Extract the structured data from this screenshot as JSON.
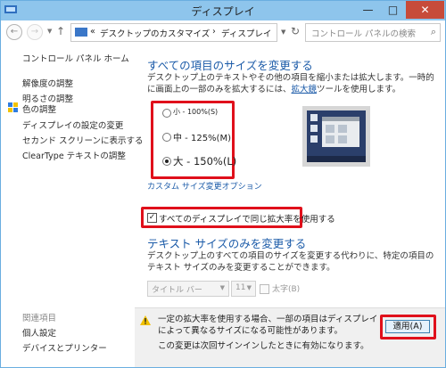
{
  "window": {
    "title": "ディスプレイ",
    "min_label": "—",
    "max_label": "□",
    "close_label": "✕"
  },
  "nav": {
    "back_icon": "back-arrow-icon",
    "forward_icon": "forward-arrow-icon",
    "breadcrumb": [
      "«",
      "デスクトップのカスタマイズ",
      "›",
      "ディスプレイ"
    ],
    "search_placeholder": "コントロール パネルの検索"
  },
  "sidebar": {
    "home": "コントロール パネル ホーム",
    "items": [
      {
        "label": "解像度の調整"
      },
      {
        "label": "明るさの調整"
      },
      {
        "label": "色の調整"
      },
      {
        "label": "ディスプレイの設定の変更"
      },
      {
        "label": "セカンド スクリーンに表示する"
      },
      {
        "label": "ClearType テキストの調整"
      }
    ],
    "related_heading": "関連項目",
    "related": [
      {
        "label": "個人設定"
      },
      {
        "label": "デバイスとプリンター"
      }
    ]
  },
  "main": {
    "heading1": "すべての項目のサイズを変更する",
    "para1_a": "デスクトップ上のテキストやその他の項目を縮小または拡大します。一時的に画面上の一部のみを拡大するには、",
    "para1_link": "拡大鏡",
    "para1_b": "ツールを使用します。",
    "size_options": [
      {
        "label": "小 - 100%(S)",
        "selected": false
      },
      {
        "label": "中 - 125%(M)",
        "selected": false
      },
      {
        "label": "大 - 150%(L)",
        "selected": true
      }
    ],
    "custom_link": "カスタム サイズ変更オプション",
    "same_scale_checkbox": "すべてのディスプレイで同じ拡大率を使用する",
    "same_scale_checked": true,
    "heading2": "テキスト サイズのみを変更する",
    "para2": "デスクトップ上のすべての項目のサイズを変更する代わりに、特定の項目のテキスト サイズのみを変更することができます。",
    "item_select": "タイトル バー",
    "size_select": "11",
    "bold_label": "太字(B)",
    "warning_line1": "一定の拡大率を使用する場合、一部の項目はディスプレイによって異なるサイズになる可能性があります。",
    "warning_line2": "この変更は次回サインインしたときに有効になります。",
    "apply_button": "適用(A)"
  },
  "colors": {
    "accent": "#1a5aa8",
    "highlight": "#e0101b",
    "titlebar": "#8ec5ec",
    "close": "#c74b3a"
  }
}
